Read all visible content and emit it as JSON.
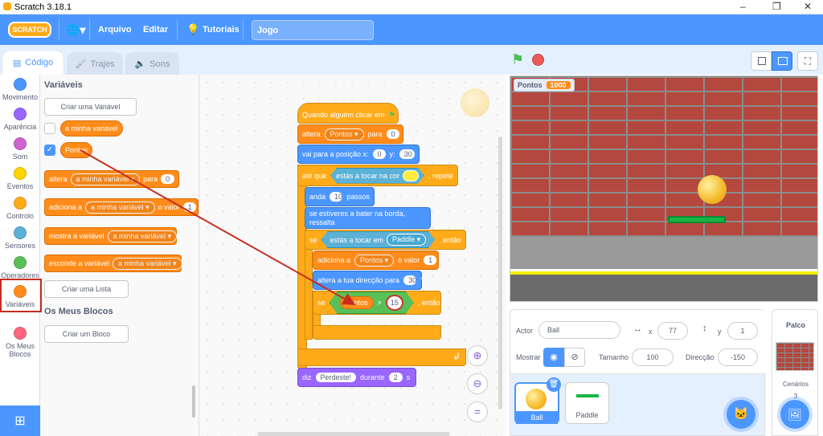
{
  "window": {
    "title": "Scratch 3.18.1",
    "min": "–",
    "max": "❐",
    "close": "✕"
  },
  "menu": {
    "logo": "SCRATCH",
    "file": "Arquivo",
    "edit": "Editar",
    "tutorials": "Tutoriais",
    "project_title": "Jogo"
  },
  "tabs": {
    "code": "Código",
    "costumes": "Trajes",
    "sounds": "Sons"
  },
  "categories": [
    {
      "label": "Movimento",
      "color": "#4c97ff"
    },
    {
      "label": "Aparência",
      "color": "#9966ff"
    },
    {
      "label": "Som",
      "color": "#cf63cf"
    },
    {
      "label": "Eventos",
      "color": "#ffd500"
    },
    {
      "label": "Controlo",
      "color": "#ffab19"
    },
    {
      "label": "Sensores",
      "color": "#5cb1d6"
    },
    {
      "label": "Operadores",
      "color": "#59c059"
    },
    {
      "label": "Variáveis",
      "color": "#ff8c1a"
    },
    {
      "label": "Os Meus Blocos",
      "color": "#ff6680"
    }
  ],
  "palette": {
    "section_vars": "Variáveis",
    "make_var": "Criar uma Variável",
    "var1": "a minha variável",
    "var2": "Pontos",
    "set_label": "altera",
    "set_var": "a minha variável",
    "set_to": "para",
    "set_val": "0",
    "change_label": "adiciona a",
    "change_var": "a minha variável",
    "change_by": "o valor",
    "change_val": "1",
    "show_label": "mostra a variável",
    "show_var": "a minha variável",
    "hide_label": "esconde a variável",
    "hide_var": "a minha variável",
    "make_list": "Criar uma Lista",
    "section_blocks": "Os Meus Blocos",
    "make_block": "Criar um Bloco"
  },
  "script": {
    "hat": "Quando alguém clicar em",
    "set1": "altera",
    "set1_var": "Pontos",
    "set1_to": "para",
    "set1_val": "0",
    "goto": "vai para a posição x:",
    "goto_x": "0",
    "goto_y_lbl": "y:",
    "goto_y": "30",
    "until": "até que",
    "touch_color": "estás a tocar na cor",
    "repeat": ", repete",
    "move": "anda",
    "move_n": "10",
    "move_unit": "passos",
    "bounce": "se estiveres a bater na borda, ressalta",
    "if1": "se",
    "touching": "estás a tocar em",
    "touch_obj": "Paddle",
    "then1": ", então",
    "change": "adiciona a",
    "change_var": "Pontos",
    "change_by": "o valor",
    "change_val": "1",
    "turn": "altera a tua direcção para",
    "turn_val": "30",
    "turn_unit": "°",
    "if2": "se",
    "cmp_var": "Pontos",
    "cmp_op": ">",
    "cmp_val": "15",
    "then2": ", então",
    "say": "diz",
    "say_text": "Perdeste!",
    "say_for": "durante",
    "say_secs": "2",
    "say_unit": "s"
  },
  "stage": {
    "var_name": "Pontos",
    "var_value": "1000"
  },
  "sprite_info": {
    "actor_label": "Actor",
    "actor": "Ball",
    "x_label": "x",
    "x": "77",
    "y_label": "y",
    "y": "1",
    "show_label": "Mostrar",
    "size_label": "Tamanho",
    "size": "100",
    "dir_label": "Direcção",
    "dir": "-150"
  },
  "sprites": [
    {
      "name": "Ball"
    },
    {
      "name": "Paddle"
    }
  ],
  "stage_panel": {
    "title": "Palco",
    "backdrops_label": "Cenários",
    "backdrops_count": "3"
  }
}
